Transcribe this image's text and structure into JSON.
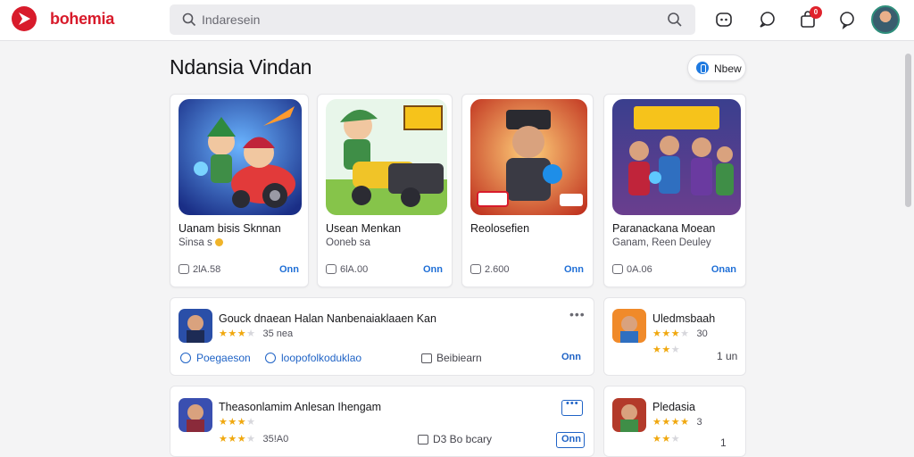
{
  "topbar": {
    "brand": "bohemia",
    "search_placeholder": "Indaresein",
    "notification_count": "0"
  },
  "colors": {
    "brand": "#d81b2b",
    "accent": "#1f63c6",
    "star": "#f0a80f"
  },
  "icons": [
    "logo-icon",
    "search-icon",
    "voice-icon",
    "chat-icon",
    "cart-icon",
    "help-icon",
    "avatar"
  ],
  "header": {
    "title": "Ndansia Vindan",
    "new_label": "Nbew"
  },
  "cards": [
    {
      "title": "Uanam bisis Sknnan",
      "subtitle": "Sinsa s",
      "count": "2lA.58",
      "action": "Onn"
    },
    {
      "title": "Usean Menkan",
      "subtitle": "Ooneb sa",
      "count": "6lA.00",
      "action": "Onn"
    },
    {
      "title": "Reolosefien",
      "subtitle": "",
      "count": "2.600",
      "action": "Onn"
    },
    {
      "title": "Paranackana Moean",
      "subtitle": "Ganam, Reen Deuley",
      "count": "0A.06",
      "action": "Onan"
    }
  ],
  "rows": [
    {
      "title": "Gouck dnaean Halan Nanbenaiaklaaen Kan",
      "rating": 3.5,
      "meta": "35 nea",
      "link1": "Poegaeson",
      "link2": "loopofolkoduklao",
      "plain": "Beibiearn",
      "action": "Onn"
    },
    {
      "title": "Theasonlamim Anlesan Ihengam",
      "rating": 3.5,
      "meta": "",
      "rating2": 3.5,
      "meta2": "35!A0",
      "plain": "D3 Bo bcary",
      "action": "Onn"
    }
  ],
  "side_rows": [
    {
      "title": "Uledmsbaah",
      "rating": 3.5,
      "meta": "30",
      "rating2": 2,
      "meta2": "1 un"
    },
    {
      "title": "Pledasia",
      "rating": 4,
      "meta": "3",
      "rating2": 2.5,
      "meta2": "1"
    }
  ]
}
